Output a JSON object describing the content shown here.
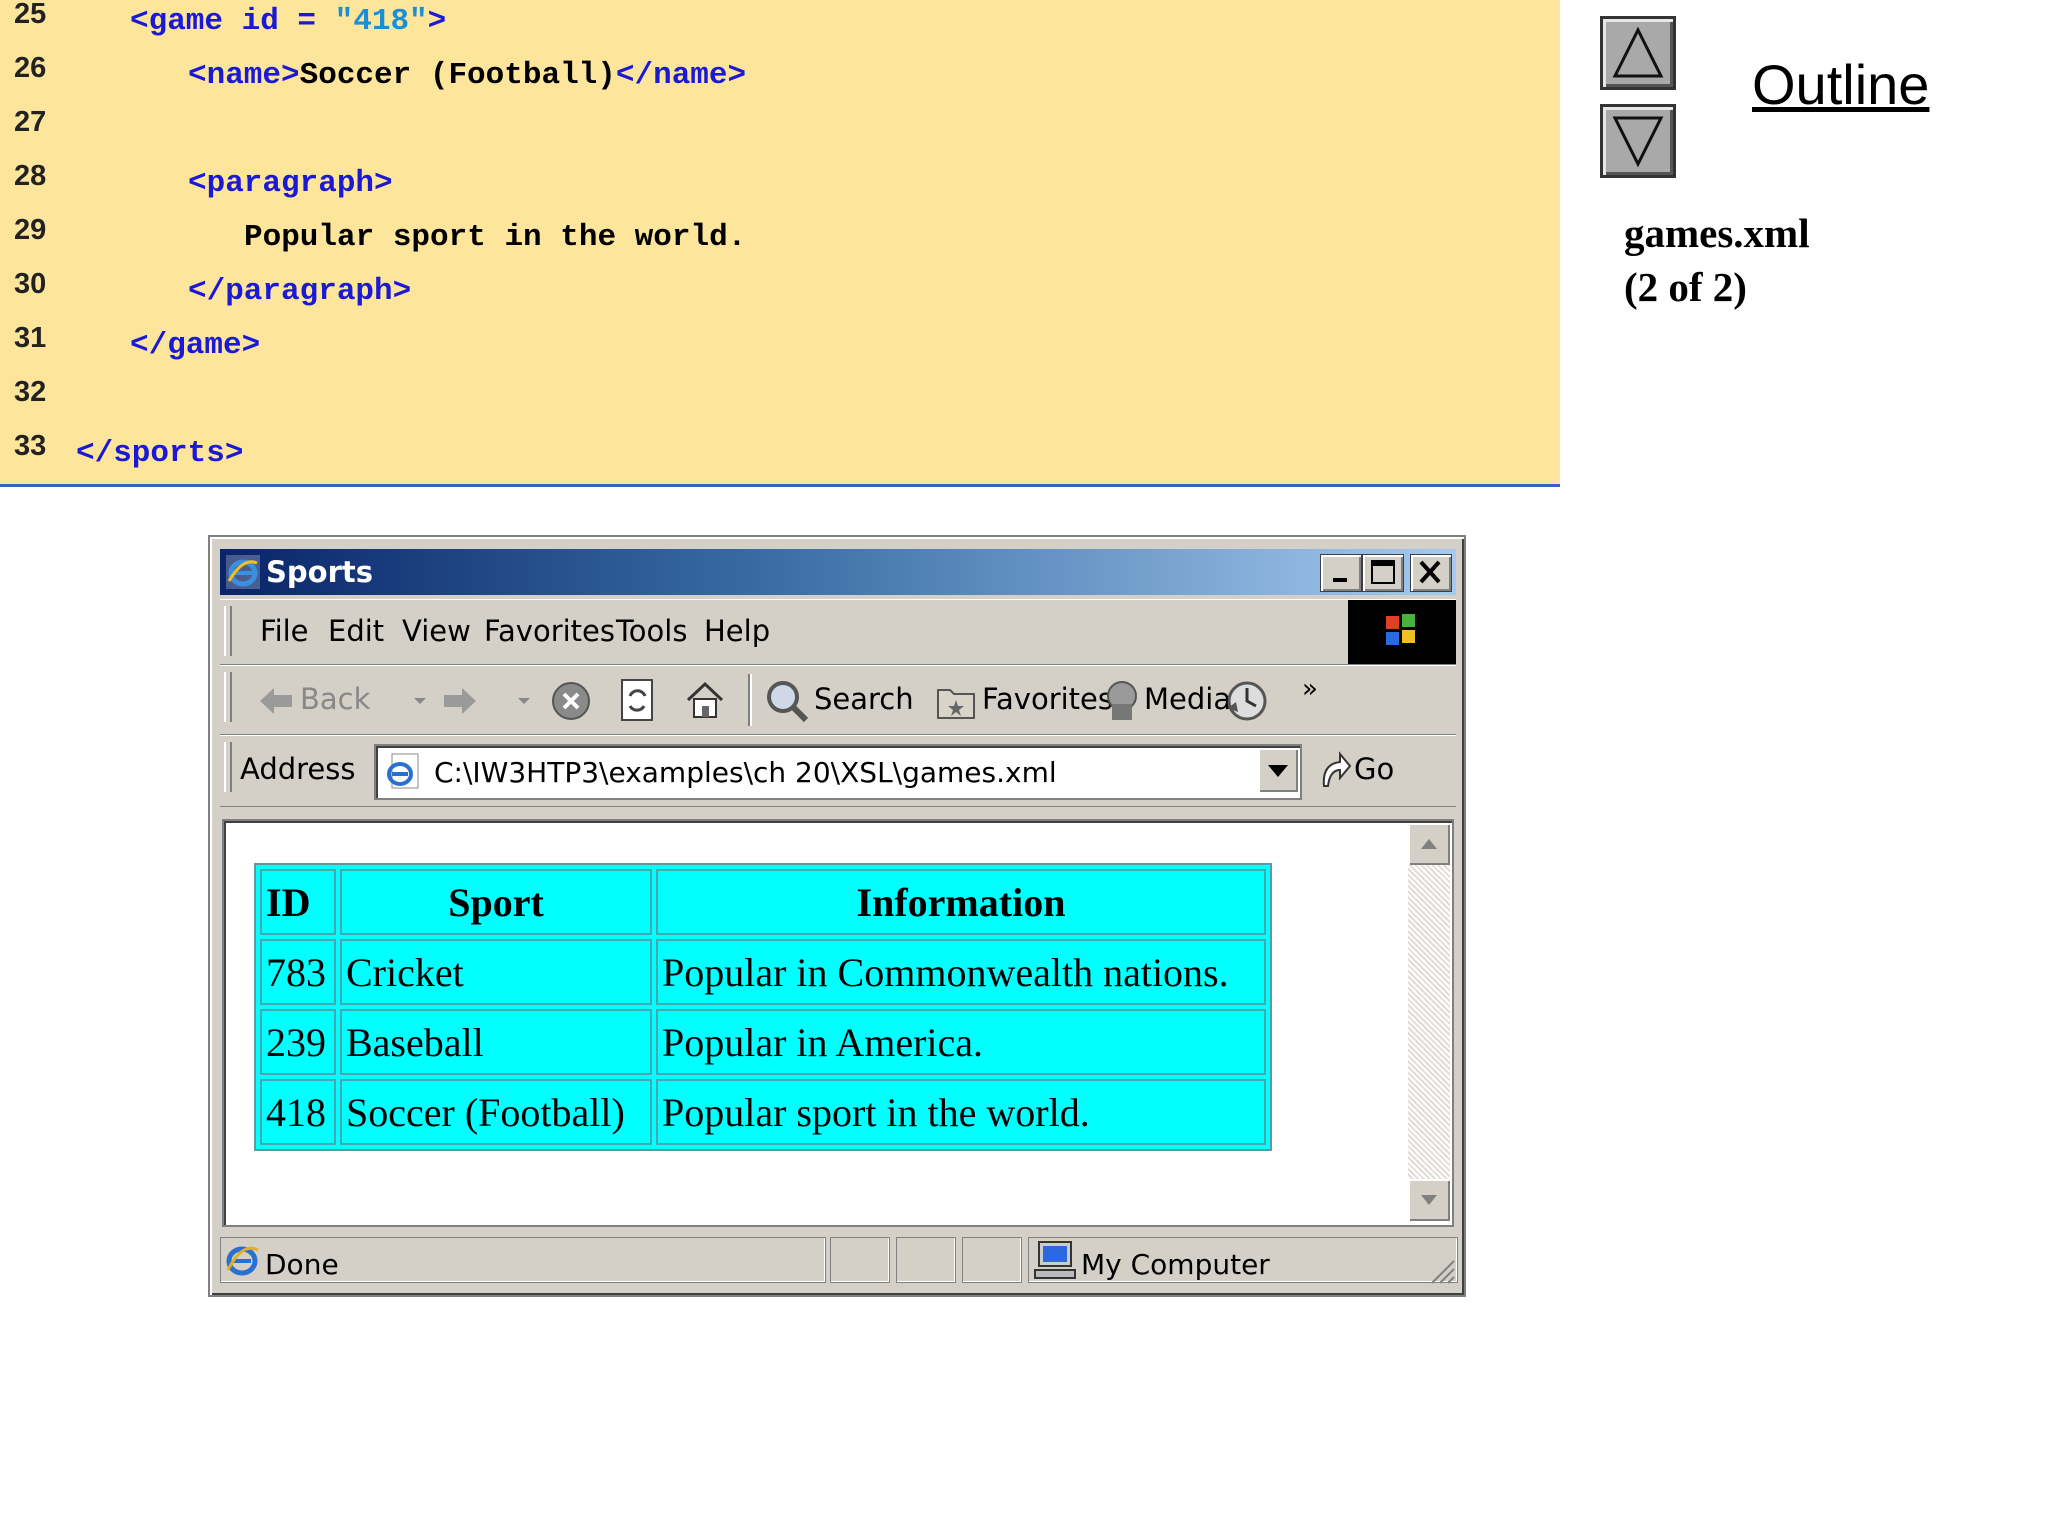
{
  "code": {
    "lines": [
      {
        "num": "25",
        "indent": 130,
        "parts": [
          {
            "t": "<game id = ",
            "c": "tag"
          },
          {
            "t": "\"418\"",
            "c": "str"
          },
          {
            "t": ">",
            "c": "tag"
          }
        ]
      },
      {
        "num": "26",
        "indent": 188,
        "parts": [
          {
            "t": "<name>",
            "c": "tag"
          },
          {
            "t": "Soccer (Football)",
            "c": "txt"
          },
          {
            "t": "</name>",
            "c": "tag"
          }
        ]
      },
      {
        "num": "27",
        "indent": 0,
        "parts": []
      },
      {
        "num": "28",
        "indent": 188,
        "parts": [
          {
            "t": "<paragraph>",
            "c": "tag"
          }
        ]
      },
      {
        "num": "29",
        "indent": 244,
        "parts": [
          {
            "t": "Popular sport in the world.",
            "c": "txt"
          }
        ]
      },
      {
        "num": "30",
        "indent": 188,
        "parts": [
          {
            "t": "</paragraph>",
            "c": "tag"
          }
        ]
      },
      {
        "num": "31",
        "indent": 130,
        "parts": [
          {
            "t": "</game>",
            "c": "tag"
          }
        ]
      },
      {
        "num": "32",
        "indent": 0,
        "parts": []
      },
      {
        "num": "33",
        "indent": 76,
        "parts": [
          {
            "t": "</sports>",
            "c": "tag"
          }
        ]
      }
    ]
  },
  "outline": {
    "title": "Outline",
    "file_name": "games.xml",
    "page_info": "(2 of 2)"
  },
  "browser": {
    "title": "Sports",
    "menu": [
      "File",
      "Edit",
      "View",
      "Favorites",
      "Tools",
      "Help"
    ],
    "toolbar": {
      "back": "Back",
      "search": "Search",
      "favorites": "Favorites",
      "media": "Media"
    },
    "address_label": "Address",
    "address_value": "C:\\IW3HTP3\\examples\\ch 20\\XSL\\games.xml",
    "go_label": "Go",
    "status_text": "Done",
    "zone_text": "My Computer"
  },
  "table": {
    "headers": [
      "ID",
      "Sport",
      "Information"
    ],
    "rows": [
      [
        "783",
        "Cricket",
        "Popular in Commonwealth nations."
      ],
      [
        "239",
        "Baseball",
        "Popular in America."
      ],
      [
        "418",
        "Soccer (Football)",
        "Popular sport in the world."
      ]
    ]
  },
  "colors": {
    "code_background": "#fee59c",
    "tag_color": "#1a1ad6",
    "string_color": "#1b8fd6",
    "table_cell": "#00ffff"
  }
}
